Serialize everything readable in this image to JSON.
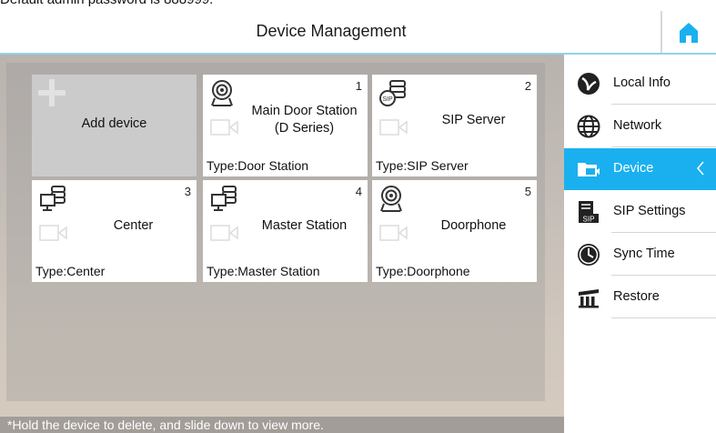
{
  "caption": "Default admin password is 888999.",
  "header": {
    "title": "Device Management",
    "home_icon": "home-icon"
  },
  "colors": {
    "accent": "#1ab0ef",
    "accent_line": "#8fd2f0"
  },
  "add_tile": {
    "label": "Add device",
    "icon": "plus-icon"
  },
  "devices": [
    {
      "number": "1",
      "name_line1": "Main Door Station",
      "name_line2": "(D Series)",
      "type": "Type:Door Station",
      "icon": "door-station-icon"
    },
    {
      "number": "2",
      "name": "SIP Server",
      "type": "Type:SIP Server",
      "icon": "sip-server-icon"
    },
    {
      "number": "3",
      "name": "Center",
      "type": "Type:Center",
      "icon": "center-icon"
    },
    {
      "number": "4",
      "name": "Master Station",
      "type": "Type:Master Station",
      "icon": "master-station-icon"
    },
    {
      "number": "5",
      "name": "Doorphone",
      "type": "Type:Doorphone",
      "icon": "doorphone-icon"
    }
  ],
  "hint": "*Hold the device to delete, and slide down to view more.",
  "sidebar": {
    "items": [
      {
        "label": "Local Info",
        "icon": "local-info-icon",
        "active": false
      },
      {
        "label": "Network",
        "icon": "globe-icon",
        "active": false
      },
      {
        "label": "Device",
        "icon": "device-folder-icon",
        "active": true
      },
      {
        "label": "SIP Settings",
        "icon": "sip-settings-icon",
        "active": false
      },
      {
        "label": "Sync Time",
        "icon": "clock-icon",
        "active": false
      },
      {
        "label": "Restore",
        "icon": "restore-icon",
        "active": false
      }
    ]
  }
}
